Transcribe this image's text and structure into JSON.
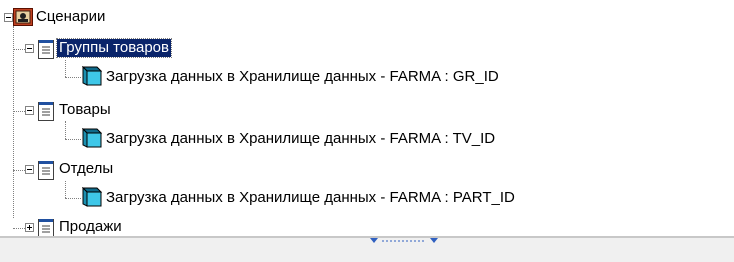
{
  "tree": {
    "root": {
      "label": "Сценарии",
      "icon": "scenario-folder-icon",
      "expanded": true
    },
    "groups": [
      {
        "label": "Группы товаров",
        "selected": true,
        "expanded": true,
        "icon": "notepad-icon",
        "child": {
          "label": "Загрузка данных в Хранилище данных - FARMA : GR_ID",
          "icon": "cube-icon"
        }
      },
      {
        "label": "Товары",
        "selected": false,
        "expanded": true,
        "icon": "notepad-icon",
        "child": {
          "label": "Загрузка данных в Хранилище данных - FARMA : TV_ID",
          "icon": "cube-icon"
        }
      },
      {
        "label": "Отделы",
        "selected": false,
        "expanded": true,
        "icon": "notepad-icon",
        "child": {
          "label": "Загрузка данных в Хранилище данных - FARMA : PART_ID",
          "icon": "cube-icon"
        }
      },
      {
        "label": "Продажи",
        "selected": false,
        "expanded": false,
        "icon": "notepad-icon"
      }
    ]
  },
  "colors": {
    "selection": "#0a246a",
    "cube_face": "#3ec7e8",
    "cube_top": "#0f6a8a"
  }
}
